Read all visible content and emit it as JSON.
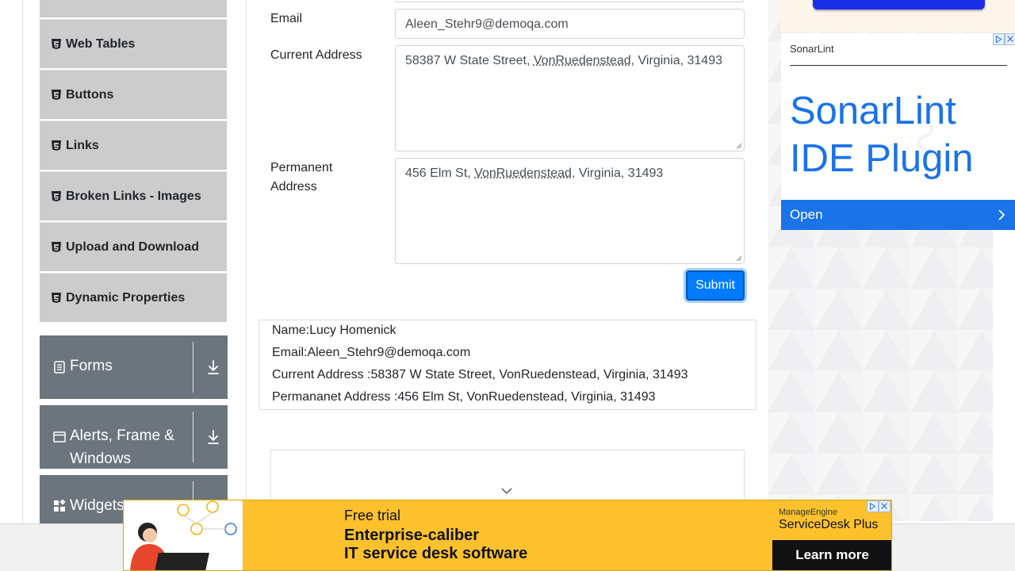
{
  "sidebar": {
    "elements_items": [
      {
        "label": ""
      },
      {
        "label": "Web Tables"
      },
      {
        "label": "Buttons"
      },
      {
        "label": "Links"
      },
      {
        "label": "Broken Links - Images"
      },
      {
        "label": "Upload and Download"
      },
      {
        "label": "Dynamic Properties"
      }
    ],
    "groups": [
      {
        "label": "Forms",
        "icon": "list-icon"
      },
      {
        "label": "Alerts, Frame & Windows",
        "icon": "window-icon"
      },
      {
        "label": "Widgets",
        "icon": "widgets-icon"
      }
    ]
  },
  "form": {
    "email_label": "Email",
    "email_value": "Aleen_Stehr9@demoqa.com",
    "current_address_label": "Current Address",
    "current_address_value": {
      "before": "58387 W State Street, ",
      "underlined": "VonRuedenstead",
      "after": ", Virginia, 31493"
    },
    "permanent_address_label_line1": "Permanent",
    "permanent_address_label_line2": "Address",
    "permanent_address_value": {
      "before": "456 Elm St, ",
      "underlined": "VonRuedenstead",
      "after": ", Virginia, 31493"
    },
    "submit_label": "Submit"
  },
  "output": {
    "name": "Name:Lucy Homenick",
    "email": "Email:Aleen_Stehr9@demoqa.com",
    "current_address": "Current Address :58387 W State Street, VonRuedenstead, Virginia, 31493",
    "permanent_address": "Permananet Address :456 Elm St, VonRuedenstead, Virginia, 31493"
  },
  "side_ad": {
    "brand": "SonarLint",
    "headline_line1": "SonarLint",
    "headline_line2": "IDE Plugin",
    "cta": "Open"
  },
  "bottom_ad": {
    "kicker": "Free trial",
    "line1": "Enterprise-caliber",
    "line2": "IT service desk software",
    "brand_small": "ManageEngine",
    "brand_product": "ServiceDesk Plus",
    "cta": "Learn more"
  },
  "colors": {
    "menu_item_bg": "#cccccc",
    "group_header_bg": "#6c757d",
    "primary": "#007bff",
    "sonar_blue": "#1a73e8",
    "banner_yellow": "#fcc12d"
  }
}
